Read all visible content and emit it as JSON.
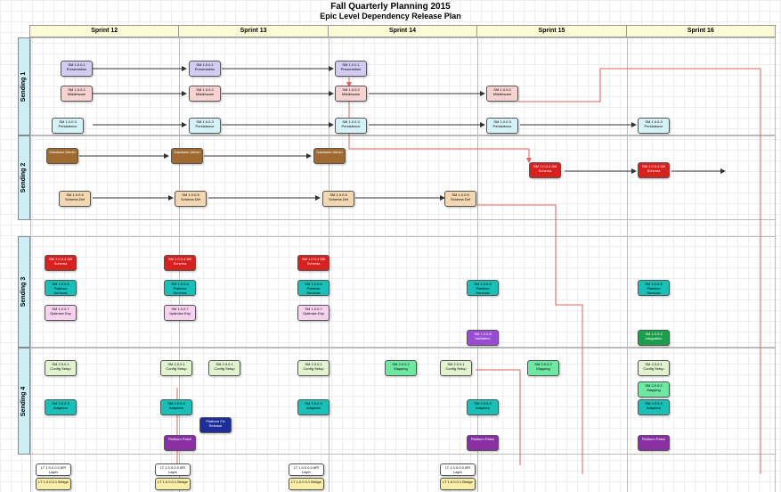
{
  "title": "Fall Quarterly Planning 2015",
  "subtitle": "Epic Level Dependency Release Plan",
  "columns": [
    "Sprint 12",
    "Sprint 13",
    "Sprint 14",
    "Sprint 15",
    "Sprint 16"
  ],
  "rows": [
    "Sending 1",
    "Sending 2",
    "Sending 3",
    "Sending 4"
  ],
  "colors": {
    "header_bg": "#fdfbd6",
    "row_label_bg": "#cdeef5",
    "dep_line_black": "#000000",
    "dep_line_red": "#e06060"
  },
  "cards": {
    "r1c1_presentation": "SM 1.0.0.1 Presentation",
    "r1c1_middle": "SM 1.0.0.2 Middleware",
    "r1c1_persist": "SM 1.0.0.3 Persistence",
    "r1c2_presentation": "SM 1.0.0.1 Presentation",
    "r1c2_middle": "SM 1.0.0.2 Middleware",
    "r1c2_persist": "SM 1.0.0.3 Persistence",
    "r1c3_presentation": "SM 1.0.0.1 Presentation",
    "r1c3_middle": "SM 1.0.0.2 Middleware",
    "r1c3_persist": "SM 1.0.0.3 Persistence",
    "r1c4_middle": "SM 1.0.0.2 Middleware",
    "r1c4_persist": "SM 1.0.0.3 Persistence",
    "r1c5_persist": "SM 1.0.0.3 Persistence",
    "r2c1_brown": "Database Admin",
    "r2c2_brown": "Database Admin",
    "r2c3_brown": "Database Admin",
    "r2c4_red": "SM 1.0.0.4 DB Schema",
    "r2c5_red": "SM 1.0.0.4 DB Schema",
    "r2c1_tan": "SM 1.0.0.5 Schema Def",
    "r2c2_tan": "SM 1.0.0.5 Schema Def",
    "r2c3_tan": "SM 1.0.0.5 Schema Def",
    "r2c4_tan": "SM 1.0.0.5 Schema Def",
    "r3c1_red": "SM 1.0.0.4 DB Schema",
    "r3c2_red": "SM 1.0.0.4 DB Schema",
    "r3c3_red": "SM 1.0.0.4 DB Schema",
    "r3c1_teal": "SM 1.0.0.6 Platform Services",
    "r3c2_teal": "SM 1.0.0.6 Platform Services",
    "r3c3_teal": "SM 1.0.0.6 Platform Services",
    "r3c4_teal": "SM 1.0.0.6 Platform Services",
    "r3c5_teal": "SM 1.0.0.6 Platform Services",
    "r3c1_lpink": "SM 1.0.0.7 Optimize Exp",
    "r3c2_lpink": "SM 1.0.0.7 Optimize Exp",
    "r3c3_lpink": "SM 1.0.0.7 Optimize Exp",
    "r3c4_violet": "SM 1.0.0.8 Validation",
    "r3c5_dgreen": "SM 1.0.0.9 Integration",
    "r4c1_lgreen": "SM 2.0.0.1 Config Setup",
    "r4c2_lgreen_a": "SM 2.0.0.1 Config Setup",
    "r4c2_lgreen_b": "SM 2.0.0.1 Config Setup",
    "r4c3_lgreen": "SM 2.0.0.1 Config Setup",
    "r4c3_green": "SM 2.0.0.2 Mapping",
    "r4c4_lgreen": "SM 2.0.0.1 Config Setup",
    "r4c4_green": "SM 2.0.0.2 Mapping",
    "r4c5_lgreen": "SM 2.0.0.1 Config Setup",
    "r4c5_green": "SM 2.0.0.2 Mapping",
    "r4c1_teal": "SM 2.0.0.3 Adapters",
    "r4c2_teal": "SM 2.0.0.3 Adapters",
    "r4c3_teal": "SM 2.0.0.3 Adapters",
    "r4c4_teal": "SM 2.0.0.3 Adapters",
    "r4c5_teal": "SM 2.0.0.3 Adapters",
    "r4c2_navy": "Platform Fix Release",
    "r4c2_dpurple": "Platform Patch",
    "r4c4_dpurple": "Platform Patch",
    "r4c5_dpurple": "Platform Patch",
    "r5_white": "LT 1.0.0.0.0 API Layer",
    "r5_yellow": "LT 1.0.0.0.1 Bridge"
  }
}
